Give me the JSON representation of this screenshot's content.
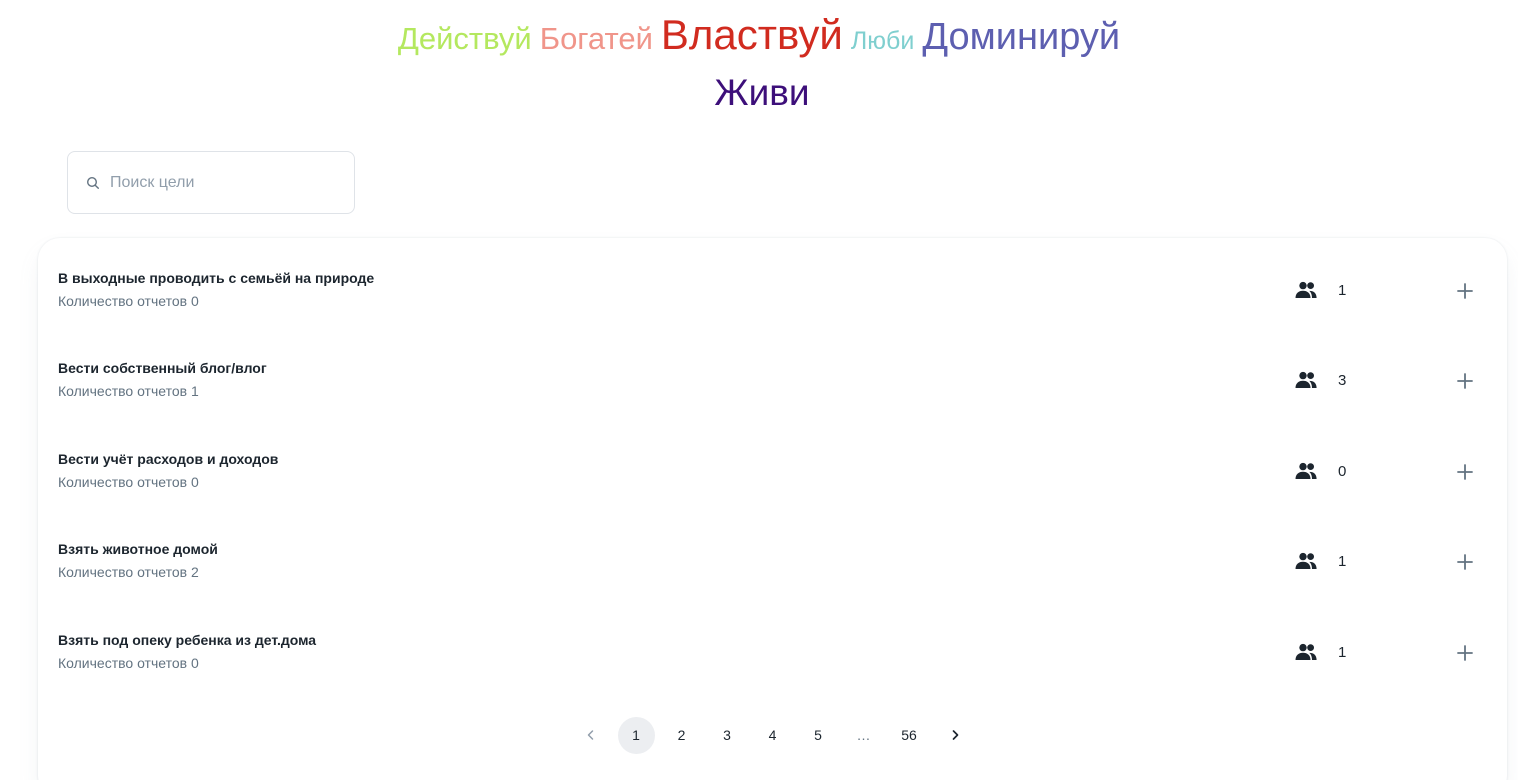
{
  "word_cloud": [
    {
      "text": "Действуй",
      "color": "#b4e85f"
    },
    {
      "text": "Богатей",
      "color": "#f0958a"
    },
    {
      "text": "Властвуй",
      "color": "#d12b1f"
    },
    {
      "text": "Люби",
      "color": "#7fcfcf"
    },
    {
      "text": "Доминируй",
      "color": "#5d5fb0"
    },
    {
      "text": "Живи",
      "color": "#3d0f7a"
    }
  ],
  "search": {
    "placeholder": "Поиск цели",
    "value": ""
  },
  "goals": [
    {
      "title": "В выходные проводить с семьёй на природе",
      "reports": "Количество отчетов 0",
      "participants": "1"
    },
    {
      "title": "Вести собственный блог/влог",
      "reports": "Количество отчетов 1",
      "participants": "3"
    },
    {
      "title": "Вести учёт расходов и доходов",
      "reports": "Количество отчетов 0",
      "participants": "0"
    },
    {
      "title": "Взять животное домой",
      "reports": "Количество отчетов 2",
      "participants": "1"
    },
    {
      "title": "Взять под опеку ребенка из дет.дома",
      "reports": "Количество отчетов 0",
      "participants": "1"
    }
  ],
  "icons": {
    "search": "search-icon",
    "participants": "people-icon",
    "add": "plus-icon",
    "prev": "chevron-left-icon",
    "next": "chevron-right-icon"
  },
  "pagination": {
    "pages": [
      "1",
      "2",
      "3",
      "4",
      "5",
      "…",
      "56"
    ],
    "current": "1"
  },
  "colors": {
    "text_primary": "#1c252e",
    "text_secondary": "#637381",
    "active_page_bg": "#eceef1"
  }
}
